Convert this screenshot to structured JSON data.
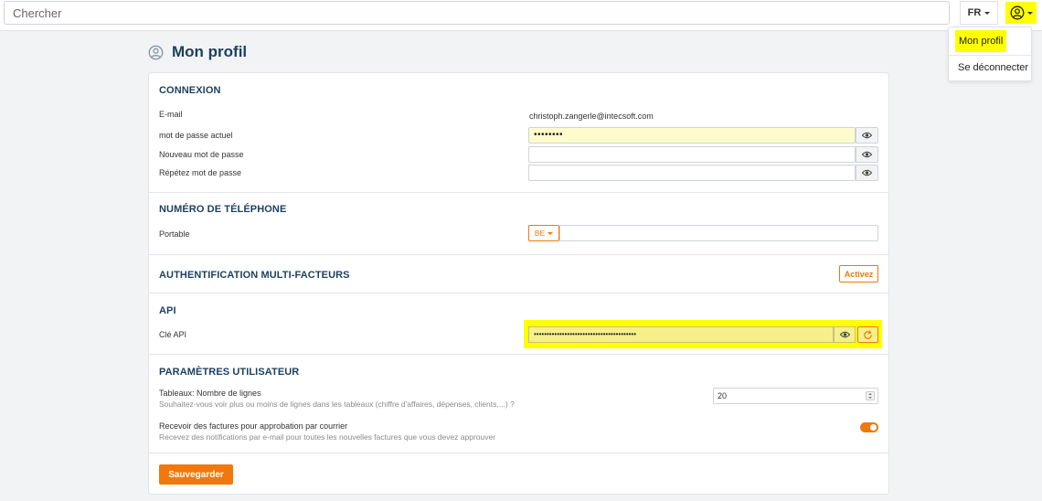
{
  "topbar": {
    "search_placeholder": "Chercher",
    "language": "FR",
    "user_menu": {
      "items": [
        "Mon profil",
        "Se déconnecter"
      ]
    }
  },
  "page": {
    "title": "Mon profil"
  },
  "connexion": {
    "title": "CONNEXION",
    "email_label": "E-mail",
    "email_value": "christoph.zangerle@intecsoft.com",
    "current_password_label": "mot de passe actuel",
    "current_password_mask": "••••••••",
    "new_password_label": "Nouveau mot de passe",
    "repeat_password_label": "Répétez mot de passe"
  },
  "phone": {
    "title": "NUMÉRO DE TÉLÉPHONE",
    "mobile_label": "Portable",
    "country_code": "BE"
  },
  "mfa": {
    "title": "AUTHENTIFICATION MULTI-FACTEURS",
    "activate_label": "Activez"
  },
  "api": {
    "title": "API",
    "key_label": "Clé API",
    "key_mask": "••••••••••••••••••••••••••••••••••••••••"
  },
  "user_settings": {
    "title": "PARAMÈTRES UTILISATEUR",
    "rows_label": "Tableaux: Nombre de lignes",
    "rows_help": "Souhaitez-vous voir plus ou moins de lignes dans les tableaux (chiffre d'affaires, dépenses, clients,...) ?",
    "rows_value": "20",
    "invoice_label": "Recevoir des factures pour approbation par courrier",
    "invoice_help": "Recevez des notifications par e-mail pour toutes les nouvelles factures que vous devez approuver",
    "invoice_enabled": true
  },
  "actions": {
    "save_label": "Sauvegarder"
  },
  "colors": {
    "accent": "#f0780c",
    "heading": "#1c3f5e",
    "highlight": "#ffff00",
    "autofill": "#fffbcc"
  },
  "icons": {
    "user": "user-circle-icon",
    "eye": "eye-icon",
    "refresh": "refresh-icon"
  }
}
